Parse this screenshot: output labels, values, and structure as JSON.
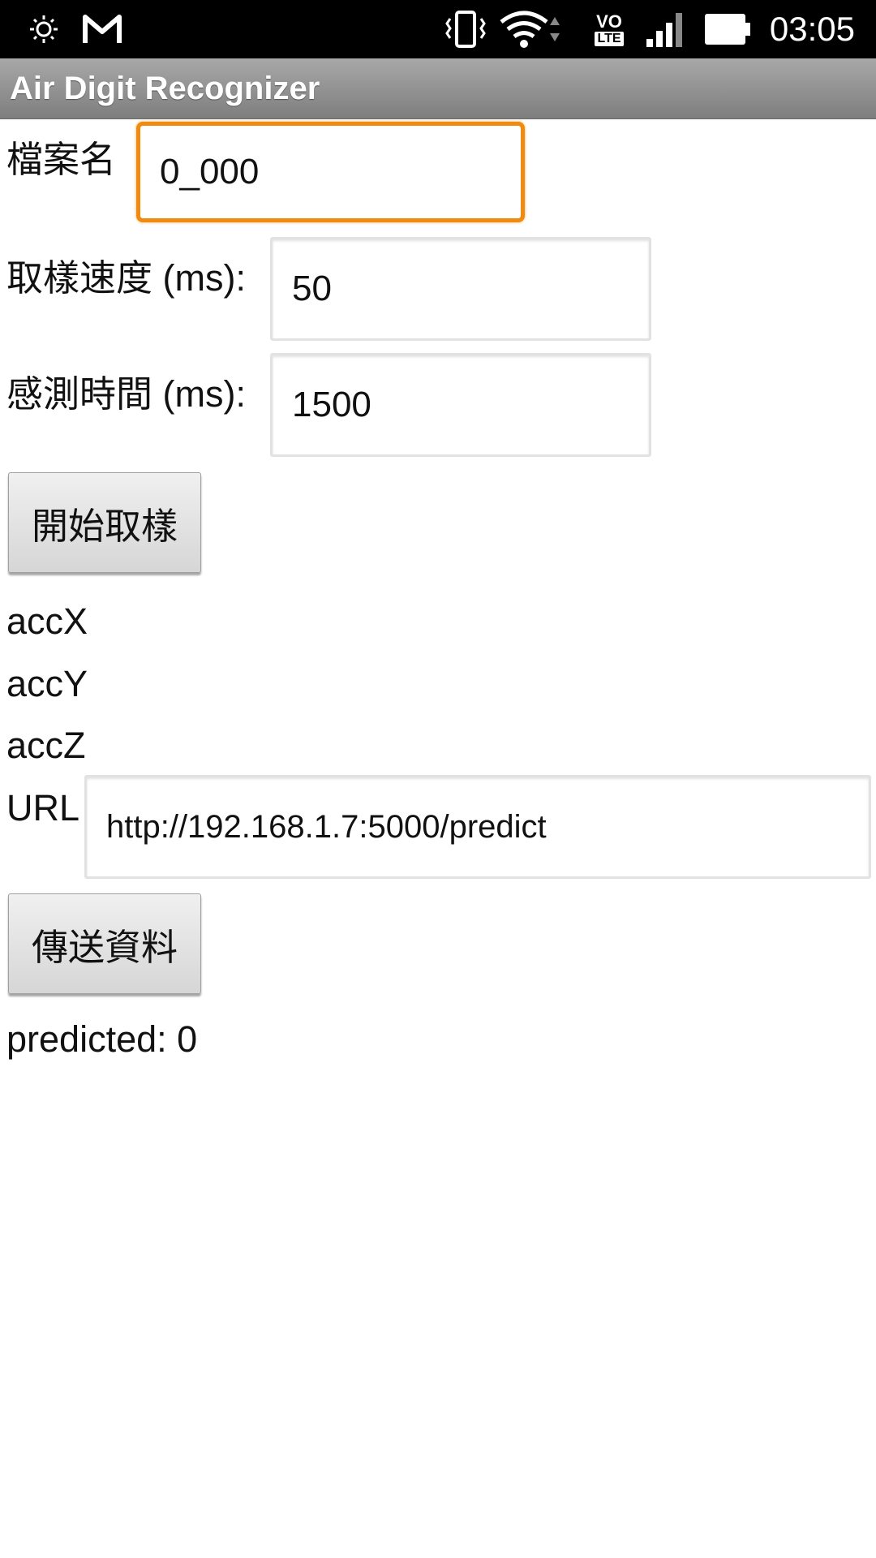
{
  "status_bar": {
    "time": "03:05",
    "volte": "VO",
    "lte": "LTE",
    "icons": [
      "brightness-icon",
      "gmail-icon",
      "vibrate-icon",
      "wifi-icon",
      "volte-icon",
      "signal-icon",
      "battery-icon"
    ]
  },
  "app": {
    "title": "Air Digit Recognizer"
  },
  "form": {
    "filename_label": "檔案名",
    "filename_value": "0_000",
    "sample_rate_label": "取樣速度 (ms):",
    "sample_rate_value": "50",
    "sense_time_label": "感測時間 (ms):",
    "sense_time_value": "1500",
    "start_button": "開始取樣",
    "acc_x": "accX",
    "acc_y": "accY",
    "acc_z": "accZ",
    "url_label": "URL",
    "url_value": "http://192.168.1.7:5000/predict",
    "send_button": "傳送資料",
    "predicted": "predicted: 0"
  },
  "colors": {
    "focus_border": "#f08a10",
    "action_bar": "#8f8f8f",
    "status_bar": "#000000"
  }
}
